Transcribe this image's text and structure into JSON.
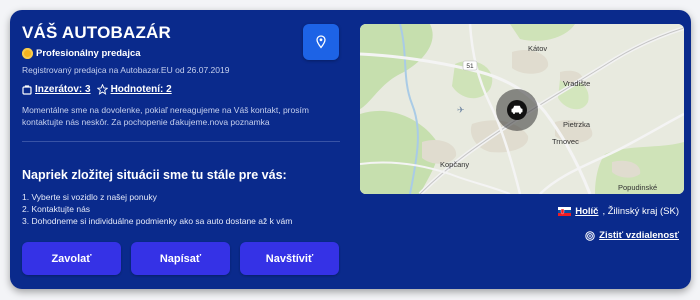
{
  "dealer": {
    "name": "VÁŠ AUTOBAZÁR",
    "badge": "Profesionálny predajca",
    "registered": "Registrovaný predajca na Autobazar.EU od 26.07.2019",
    "listings": "Inzerátov: 3",
    "ratings": "Hodnotení: 2",
    "description": "Momentálne sme na dovolenke, pokiaľ nereagujeme na Váš kontakt, prosím kontaktujte nás neskôr. Za pochopenie ďakujeme.nova poznamka"
  },
  "help": {
    "title": "Napriek zložitej situácii sme tu stále pre vás:",
    "items": [
      "1. Vyberte si vozidlo z našej ponuky",
      "2. Kontaktujte nás",
      "3. Dohodneme si individuálne podmienky ako sa auto dostane až k vám"
    ]
  },
  "buttons": {
    "call": "Zavolať",
    "write": "Napísať",
    "visit": "Navštíviť"
  },
  "map": {
    "labels": {
      "katov": "Kátov",
      "vradiste": "Vradište",
      "pieztrka": "Pietrzka",
      "trnovec": "Trnovec",
      "kopcany": "Kopčany",
      "popudinske": "Popudinské",
      "road": "51"
    }
  },
  "location": {
    "city": "Holíč",
    "region": ", Žilinský kraj (SK)",
    "distance": "Zistiť vzdialenosť"
  },
  "colors": {
    "card": "#0a2a8c",
    "button": "#3532e6",
    "pin_button": "#1d63e6"
  }
}
